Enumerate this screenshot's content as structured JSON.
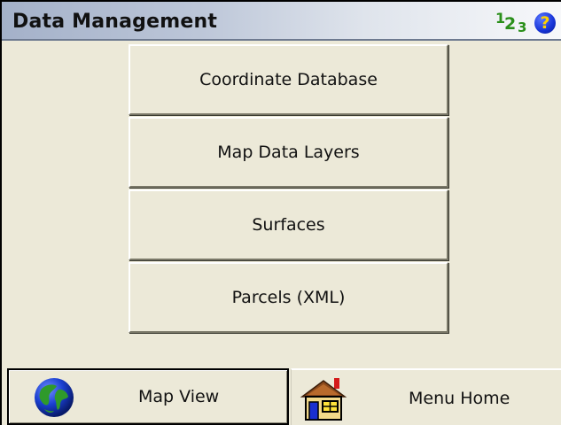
{
  "window": {
    "title": "Data Management",
    "numpad_digits": [
      "1",
      "2",
      "3"
    ],
    "help_label": "?"
  },
  "menu": {
    "items": [
      {
        "label": "Coordinate Database"
      },
      {
        "label": "Map Data Layers"
      },
      {
        "label": "Surfaces"
      },
      {
        "label": "Parcels (XML)"
      }
    ]
  },
  "bottom": {
    "map_view_label": "Map View",
    "menu_home_label": "Menu Home",
    "map_view_icon": "globe-icon",
    "menu_home_icon": "house-icon"
  },
  "colors": {
    "background": "#ece9d8",
    "title_gradient_start": "#a4b1c9",
    "numpad_green": "#2a8f1a",
    "help_blue": "#1633d6",
    "help_yellow": "#ffd200"
  }
}
